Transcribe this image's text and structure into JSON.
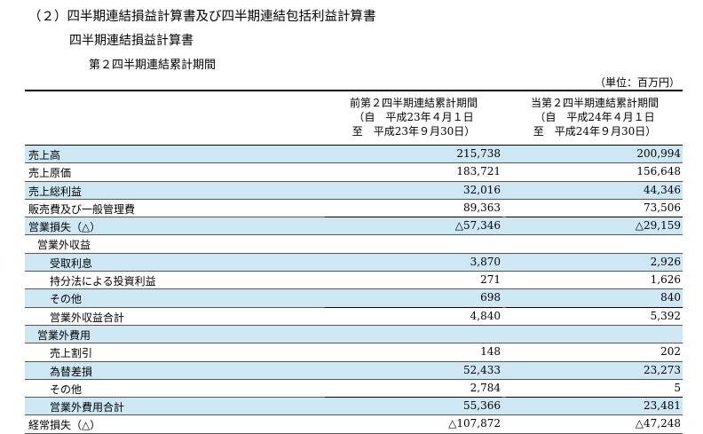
{
  "header": {
    "section_title": "（２）四半期連結損益計算書及び四半期連結包括利益計算書",
    "statement_title": "四半期連結損益計算書",
    "period_title": "第２四半期連結累計期間",
    "unit": "（単位：百万円）"
  },
  "columns": {
    "prior": [
      "前第２四半期連結累計期間",
      "（自　平成23年４月１日",
      "至　平成23年９月30日）"
    ],
    "current": [
      "当第２四半期連結累計期間",
      "（自　平成24年４月１日",
      "至　平成24年９月30日）"
    ]
  },
  "rows": [
    {
      "label": "売上高",
      "prior": "215,738",
      "current": "200,994",
      "level": 0,
      "shade": true,
      "total": false
    },
    {
      "label": "売上原価",
      "prior": "183,721",
      "current": "156,648",
      "level": 0,
      "shade": false,
      "total": false
    },
    {
      "label": "売上総利益",
      "prior": "32,016",
      "current": "44,346",
      "level": 0,
      "shade": true,
      "total": false
    },
    {
      "label": "販売費及び一般管理費",
      "prior": "89,363",
      "current": "73,506",
      "level": 0,
      "shade": false,
      "total": true
    },
    {
      "label": "営業損失（△）",
      "prior": "△57,346",
      "current": "△29,159",
      "level": 0,
      "shade": true,
      "total": false
    },
    {
      "label": "営業外収益",
      "prior": "",
      "current": "",
      "level": 1,
      "shade": false,
      "total": false
    },
    {
      "label": "受取利息",
      "prior": "3,870",
      "current": "2,926",
      "level": 2,
      "shade": true,
      "total": false
    },
    {
      "label": "持分法による投資利益",
      "prior": "271",
      "current": "1,626",
      "level": 2,
      "shade": false,
      "total": false
    },
    {
      "label": "その他",
      "prior": "698",
      "current": "840",
      "level": 2,
      "shade": true,
      "total": true
    },
    {
      "label": "営業外収益合計",
      "prior": "4,840",
      "current": "5,392",
      "level": 3,
      "shade": false,
      "total": false
    },
    {
      "label": "営業外費用",
      "prior": "",
      "current": "",
      "level": 1,
      "shade": true,
      "total": false
    },
    {
      "label": "売上割引",
      "prior": "148",
      "current": "202",
      "level": 2,
      "shade": false,
      "total": false
    },
    {
      "label": "為替差損",
      "prior": "52,433",
      "current": "23,273",
      "level": 2,
      "shade": true,
      "total": false
    },
    {
      "label": "その他",
      "prior": "2,784",
      "current": "5",
      "level": 2,
      "shade": false,
      "total": true
    },
    {
      "label": "営業外費用合計",
      "prior": "55,366",
      "current": "23,481",
      "level": 3,
      "shade": true,
      "total": false
    },
    {
      "label": "経常損失（△）",
      "prior": "△107,872",
      "current": "△47,248",
      "level": 0,
      "shade": false,
      "total": false
    }
  ]
}
